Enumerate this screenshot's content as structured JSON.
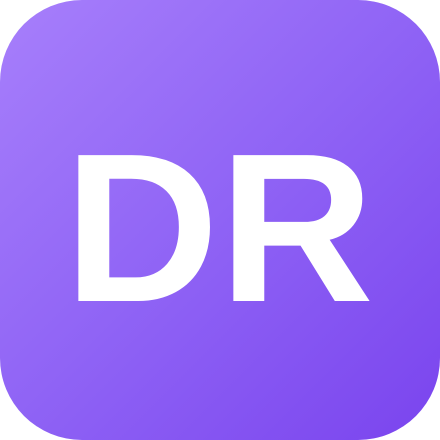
{
  "icon": {
    "initials": "DR",
    "text_color": "#ffffff",
    "gradient_start": "#a77ffb",
    "gradient_mid": "#8f63f5",
    "gradient_end": "#7a44ee"
  }
}
